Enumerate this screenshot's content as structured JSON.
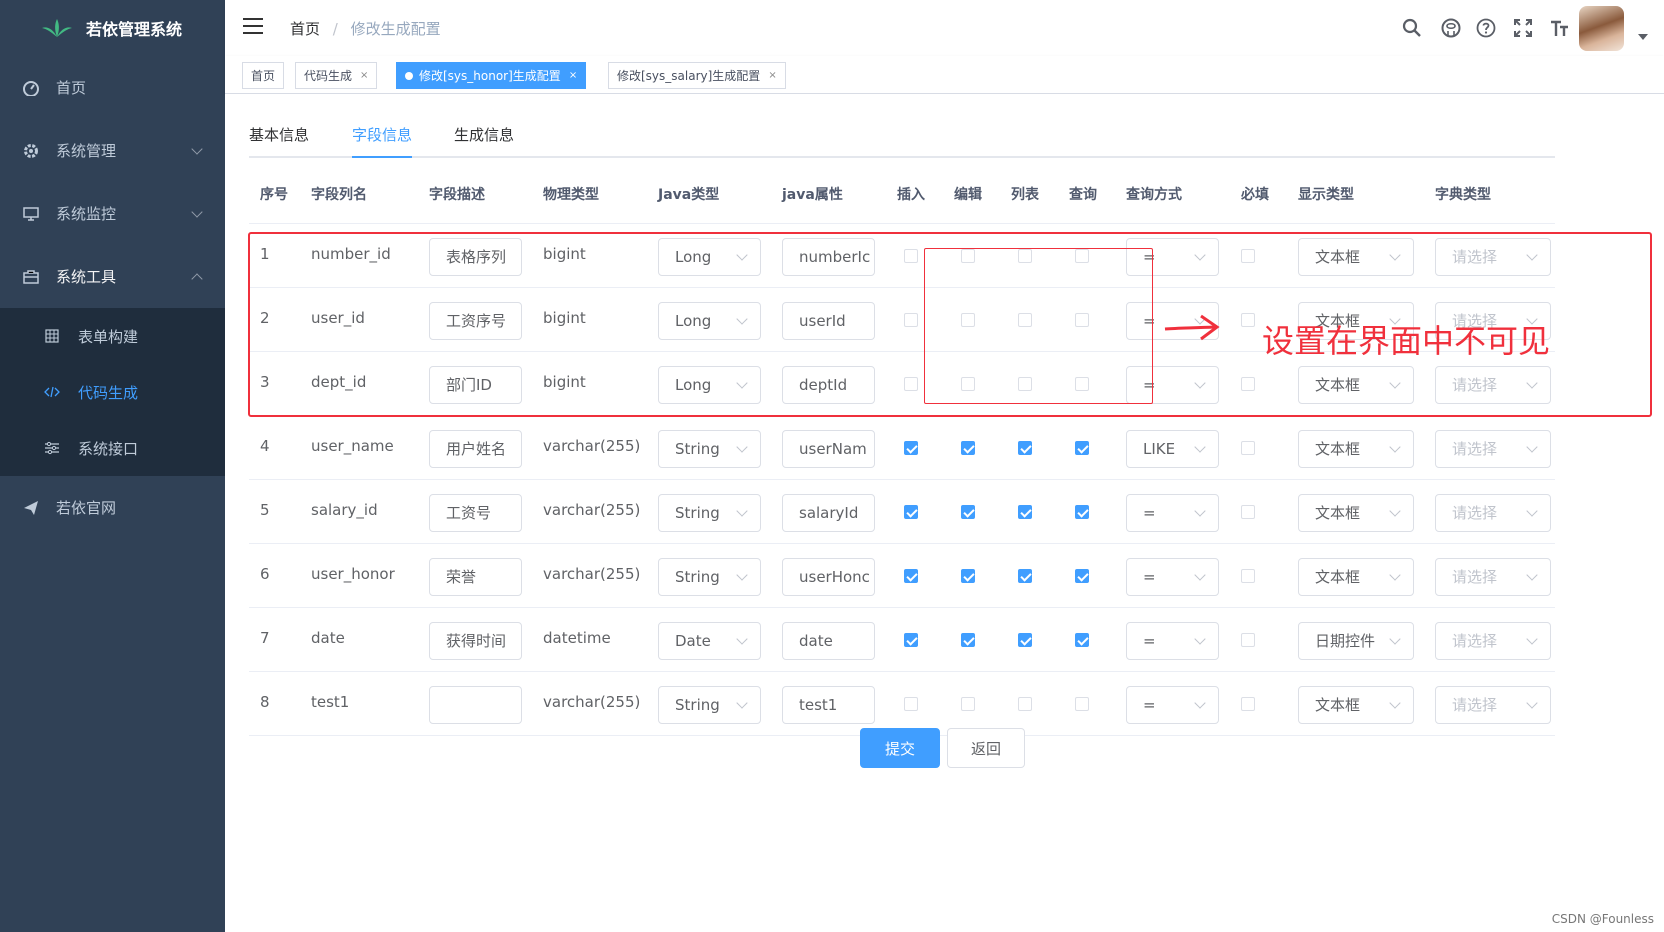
{
  "app": {
    "title": "若依管理系统"
  },
  "sidebar": {
    "items": [
      {
        "label": "首页",
        "icon": "dashboard-icon"
      },
      {
        "label": "系统管理",
        "icon": "gear-icon"
      },
      {
        "label": "系统监控",
        "icon": "monitor-icon"
      },
      {
        "label": "系统工具",
        "icon": "toolbox-icon"
      },
      {
        "label": "若依官网",
        "icon": "send-icon"
      }
    ],
    "submenu": [
      {
        "label": "表单构建",
        "icon": "grid-icon"
      },
      {
        "label": "代码生成",
        "icon": "code-icon",
        "active": true
      },
      {
        "label": "系统接口",
        "icon": "sliders-icon"
      }
    ]
  },
  "header": {
    "breadcrumb": {
      "home": "首页",
      "sep": "/",
      "current": "修改生成配置"
    }
  },
  "tags": [
    {
      "label": "首页"
    },
    {
      "label": "代码生成",
      "close": "×"
    },
    {
      "label": "修改[sys_honor]生成配置",
      "close": "×",
      "active": true
    },
    {
      "label": "修改[sys_salary]生成配置",
      "close": "×"
    }
  ],
  "tabs": [
    {
      "label": "基本信息"
    },
    {
      "label": "字段信息",
      "active": true
    },
    {
      "label": "生成信息"
    }
  ],
  "table": {
    "headers": [
      "序号",
      "字段列名",
      "字段描述",
      "物理类型",
      "Java类型",
      "java属性",
      "插入",
      "编辑",
      "列表",
      "查询",
      "查询方式",
      "必填",
      "显示类型",
      "字典类型"
    ],
    "rows": [
      {
        "seq": "1",
        "column": "number_id",
        "desc": "表格序列",
        "phys": "bigint",
        "jtype": "Long",
        "jprop": "numberIc",
        "ins": false,
        "edit": false,
        "list": false,
        "query": false,
        "qmode": "=",
        "req": false,
        "disp": "文本框",
        "dict": "请选择"
      },
      {
        "seq": "2",
        "column": "user_id",
        "desc": "工资序号",
        "phys": "bigint",
        "jtype": "Long",
        "jprop": "userId",
        "ins": false,
        "edit": false,
        "list": false,
        "query": false,
        "qmode": "=",
        "req": false,
        "disp": "文本框",
        "dict": "请选择"
      },
      {
        "seq": "3",
        "column": "dept_id",
        "desc": "部门ID",
        "phys": "bigint",
        "jtype": "Long",
        "jprop": "deptId",
        "ins": false,
        "edit": false,
        "list": false,
        "query": false,
        "qmode": "=",
        "req": false,
        "disp": "文本框",
        "dict": "请选择"
      },
      {
        "seq": "4",
        "column": "user_name",
        "desc": "用户姓名",
        "phys": "varchar(255)",
        "jtype": "String",
        "jprop": "userNam",
        "ins": true,
        "edit": true,
        "list": true,
        "query": true,
        "qmode": "LIKE",
        "req": false,
        "disp": "文本框",
        "dict": "请选择"
      },
      {
        "seq": "5",
        "column": "salary_id",
        "desc": "工资号",
        "phys": "varchar(255)",
        "jtype": "String",
        "jprop": "salaryId",
        "ins": true,
        "edit": true,
        "list": true,
        "query": true,
        "qmode": "=",
        "req": false,
        "disp": "文本框",
        "dict": "请选择"
      },
      {
        "seq": "6",
        "column": "user_honor",
        "desc": "荣誉",
        "phys": "varchar(255)",
        "jtype": "String",
        "jprop": "userHonc",
        "ins": true,
        "edit": true,
        "list": true,
        "query": true,
        "qmode": "=",
        "req": false,
        "disp": "文本框",
        "dict": "请选择"
      },
      {
        "seq": "7",
        "column": "date",
        "desc": "获得时间",
        "phys": "datetime",
        "jtype": "Date",
        "jprop": "date",
        "ins": true,
        "edit": true,
        "list": true,
        "query": true,
        "qmode": "=",
        "req": false,
        "disp": "日期控件",
        "dict": "请选择"
      },
      {
        "seq": "8",
        "column": "test1",
        "desc": "",
        "phys": "varchar(255)",
        "jtype": "String",
        "jprop": "test1",
        "ins": false,
        "edit": false,
        "list": false,
        "query": false,
        "qmode": "=",
        "req": false,
        "disp": "文本框",
        "dict": "请选择"
      }
    ]
  },
  "buttons": {
    "submit": "提交",
    "back": "返回"
  },
  "annotation": {
    "text": "设置在界面中不可见",
    "color": "#f0303c"
  },
  "watermark": "CSDN @Founless",
  "colors": {
    "sidebar_bg": "#304156",
    "submenu_bg": "#1f2d3d",
    "accent": "#409eff"
  }
}
